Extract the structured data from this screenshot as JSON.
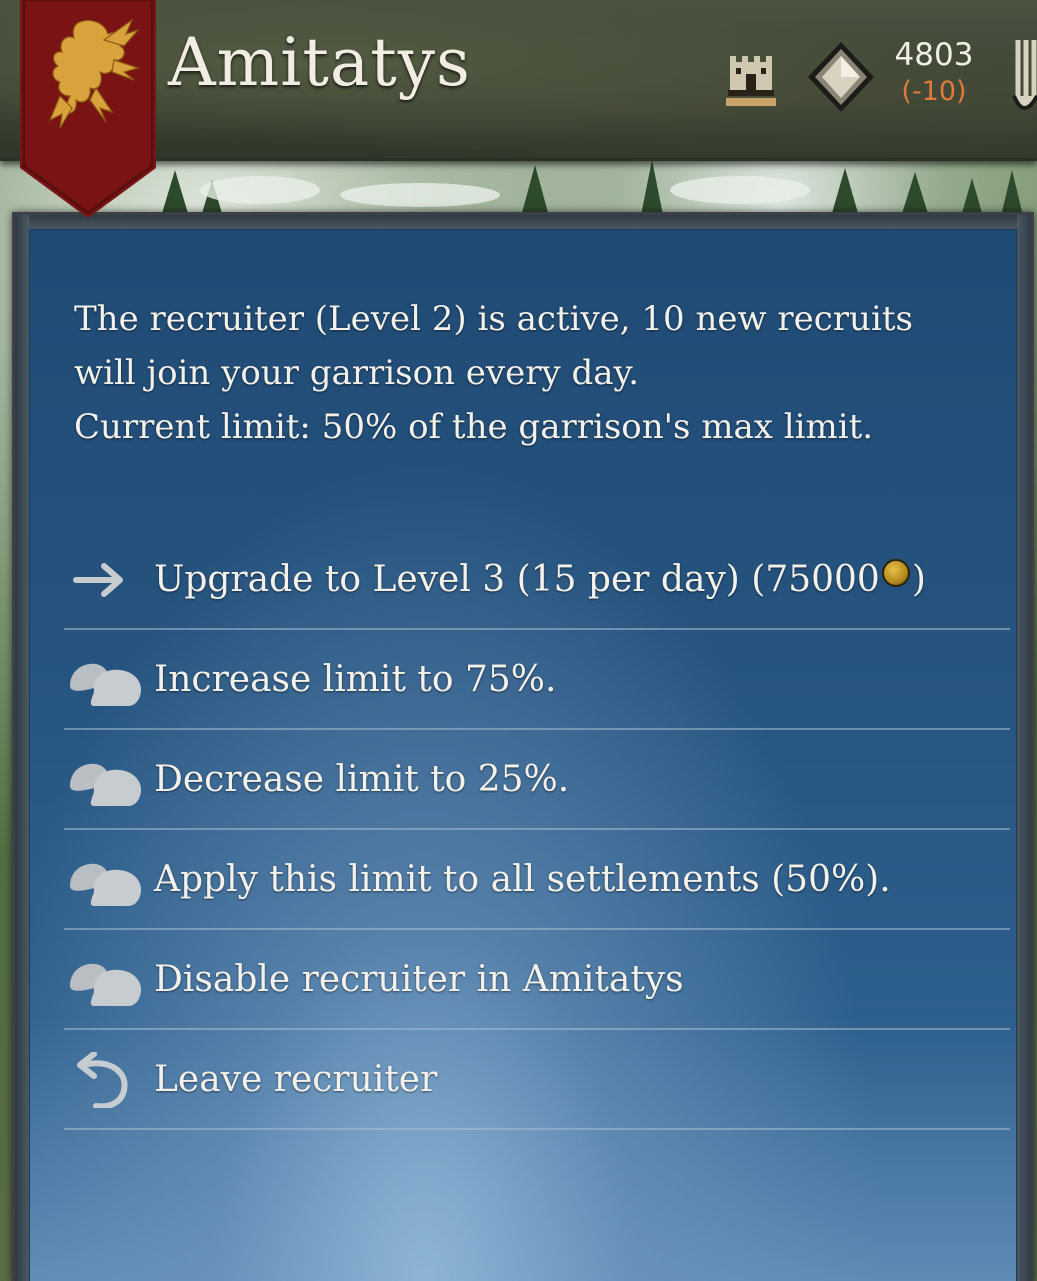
{
  "header": {
    "settlement_name": "Amitatys",
    "stat_value": "4803",
    "stat_change": "(-10)",
    "icons": [
      "castle-icon",
      "diamond-icon"
    ],
    "banner_color": "#7a1414",
    "stat_change_color": "#e07b3c"
  },
  "dialog": {
    "description_lines": [
      "The recruiter (Level 2) is active, 10 new recruits",
      "will join your garrison every day.",
      "Current limit: 50% of the garrison's max limit."
    ],
    "options": [
      {
        "icon": "arrow-right-icon",
        "label_before": "Upgrade to Level 3 (15 per day) (75000",
        "label_after": ")",
        "has_coin": true
      },
      {
        "icon": "speech-bubbles-icon",
        "label": "Increase limit to 75%."
      },
      {
        "icon": "speech-bubbles-icon",
        "label": "Decrease limit to 25%."
      },
      {
        "icon": "speech-bubbles-icon",
        "label": "Apply this limit to all settlements (50%)."
      },
      {
        "icon": "speech-bubbles-icon",
        "label": "Disable recruiter in Amitatys"
      },
      {
        "icon": "return-arrow-icon",
        "label": "Leave recruiter"
      }
    ]
  }
}
